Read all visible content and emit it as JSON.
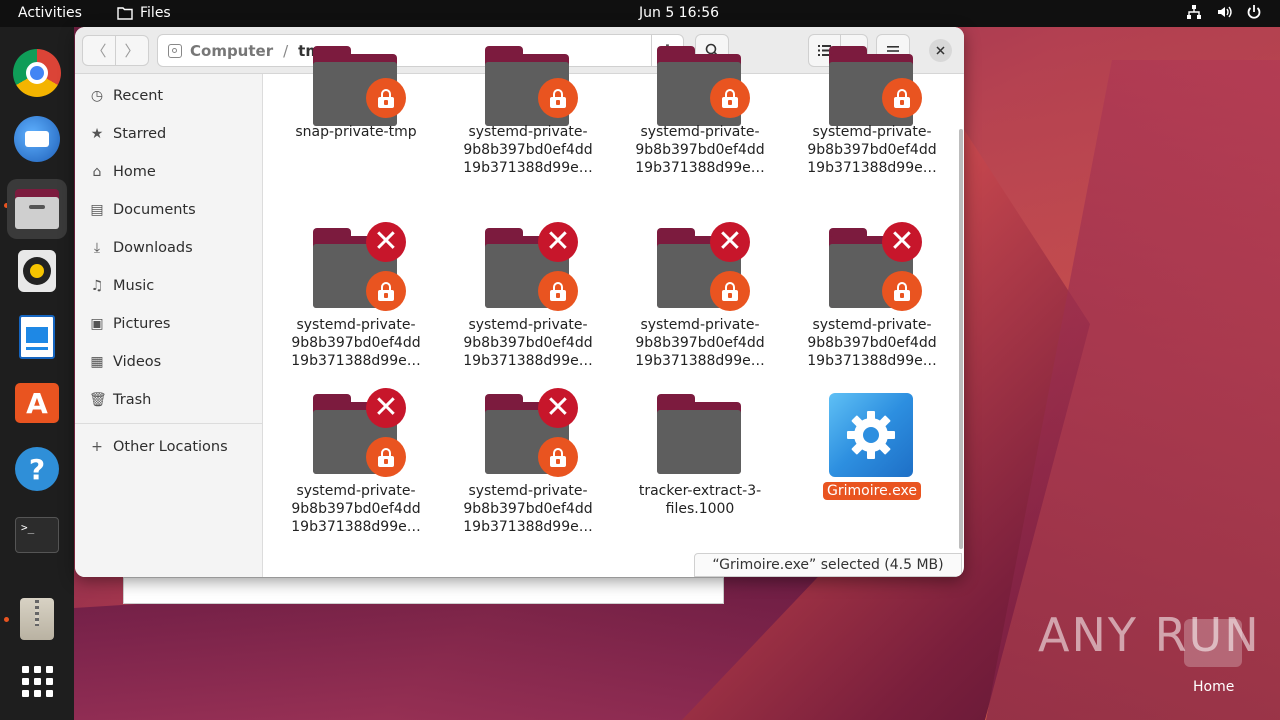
{
  "topbar": {
    "activities": "Activities",
    "app_name": "Files",
    "clock": "Jun 5  16:56",
    "tray": {
      "network_icon": "network-icon",
      "volume_icon": "volume-icon",
      "power_icon": "power-icon"
    }
  },
  "dock": {
    "items": [
      {
        "name": "chrome",
        "icon": "chrome-icon"
      },
      {
        "name": "thunderbird",
        "icon": "thunderbird-icon"
      },
      {
        "name": "files",
        "icon": "files-icon",
        "active": true
      },
      {
        "name": "rhythmbox",
        "icon": "rhythmbox-icon"
      },
      {
        "name": "writer",
        "icon": "writer-icon"
      },
      {
        "name": "software",
        "icon": "software-icon"
      },
      {
        "name": "help",
        "icon": "help-icon"
      },
      {
        "name": "terminal",
        "icon": "terminal-icon"
      },
      {
        "name": "archive",
        "icon": "archive-icon"
      },
      {
        "name": "apps",
        "icon": "app-grid-icon"
      }
    ]
  },
  "files": {
    "path": {
      "root": "Computer",
      "separator": "/",
      "current": "tmp"
    },
    "sidebar": [
      {
        "label": "Recent",
        "icon": "clock-icon"
      },
      {
        "label": "Starred",
        "icon": "star-icon"
      },
      {
        "label": "Home",
        "icon": "home-icon"
      },
      {
        "label": "Documents",
        "icon": "document-icon"
      },
      {
        "label": "Downloads",
        "icon": "download-icon"
      },
      {
        "label": "Music",
        "icon": "music-icon"
      },
      {
        "label": "Pictures",
        "icon": "picture-icon"
      },
      {
        "label": "Videos",
        "icon": "video-icon"
      },
      {
        "label": "Trash",
        "icon": "trash-icon"
      },
      {
        "label": "Other Locations",
        "icon": "plus-icon"
      }
    ],
    "items": [
      {
        "line1": "snap-private-tmp",
        "line2": "",
        "line3": ""
      },
      {
        "line1": "systemd-private-",
        "line2": "9b8b397bd0ef4dd",
        "line3": "19b371388d99e…"
      },
      {
        "line1": "systemd-private-",
        "line2": "9b8b397bd0ef4dd",
        "line3": "19b371388d99e…"
      },
      {
        "line1": "systemd-private-",
        "line2": "9b8b397bd0ef4dd",
        "line3": "19b371388d99e…"
      },
      {
        "line1": "systemd-private-",
        "line2": "9b8b397bd0ef4dd",
        "line3": "19b371388d99e…"
      },
      {
        "line1": "systemd-private-",
        "line2": "9b8b397bd0ef4dd",
        "line3": "19b371388d99e…"
      },
      {
        "line1": "systemd-private-",
        "line2": "9b8b397bd0ef4dd",
        "line3": "19b371388d99e…"
      },
      {
        "line1": "systemd-private-",
        "line2": "9b8b397bd0ef4dd",
        "line3": "19b371388d99e…"
      },
      {
        "line1": "systemd-private-",
        "line2": "9b8b397bd0ef4dd",
        "line3": "19b371388d99e…"
      },
      {
        "line1": "systemd-private-",
        "line2": "9b8b397bd0ef4dd",
        "line3": "19b371388d99e…"
      },
      {
        "line1": "tracker-extract-3-",
        "line2": "files.1000",
        "line3": ""
      },
      {
        "line1": "Grimoire.exe",
        "line2": "",
        "line3": ""
      }
    ],
    "status": "“Grimoire.exe” selected  (4.5 MB)"
  },
  "desktop": {
    "home_label": "Home",
    "watermark": "ANY RUN"
  },
  "colors": {
    "accent": "#e95420",
    "folder_top": "#7c1b3e",
    "folder_front": "#5e5e5e",
    "error_red": "#c7162b"
  }
}
